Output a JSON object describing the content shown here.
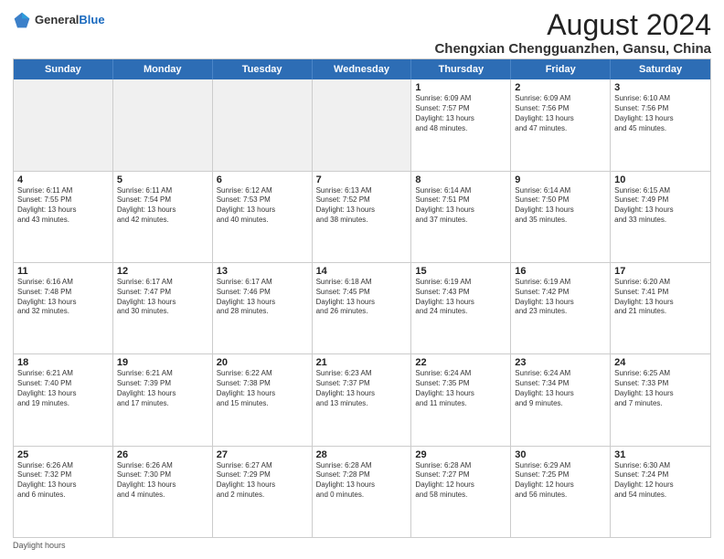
{
  "header": {
    "logo_general": "General",
    "logo_blue": "Blue",
    "month_title": "August 2024",
    "location": "Chengxian Chengguanzhen, Gansu, China"
  },
  "days_of_week": [
    "Sunday",
    "Monday",
    "Tuesday",
    "Wednesday",
    "Thursday",
    "Friday",
    "Saturday"
  ],
  "footer_text": "Daylight hours",
  "weeks": [
    [
      {
        "day": "",
        "info": "",
        "shaded": true
      },
      {
        "day": "",
        "info": "",
        "shaded": true
      },
      {
        "day": "",
        "info": "",
        "shaded": true
      },
      {
        "day": "",
        "info": "",
        "shaded": true
      },
      {
        "day": "1",
        "info": "Sunrise: 6:09 AM\nSunset: 7:57 PM\nDaylight: 13 hours\nand 48 minutes."
      },
      {
        "day": "2",
        "info": "Sunrise: 6:09 AM\nSunset: 7:56 PM\nDaylight: 13 hours\nand 47 minutes."
      },
      {
        "day": "3",
        "info": "Sunrise: 6:10 AM\nSunset: 7:56 PM\nDaylight: 13 hours\nand 45 minutes."
      }
    ],
    [
      {
        "day": "4",
        "info": "Sunrise: 6:11 AM\nSunset: 7:55 PM\nDaylight: 13 hours\nand 43 minutes."
      },
      {
        "day": "5",
        "info": "Sunrise: 6:11 AM\nSunset: 7:54 PM\nDaylight: 13 hours\nand 42 minutes."
      },
      {
        "day": "6",
        "info": "Sunrise: 6:12 AM\nSunset: 7:53 PM\nDaylight: 13 hours\nand 40 minutes."
      },
      {
        "day": "7",
        "info": "Sunrise: 6:13 AM\nSunset: 7:52 PM\nDaylight: 13 hours\nand 38 minutes."
      },
      {
        "day": "8",
        "info": "Sunrise: 6:14 AM\nSunset: 7:51 PM\nDaylight: 13 hours\nand 37 minutes."
      },
      {
        "day": "9",
        "info": "Sunrise: 6:14 AM\nSunset: 7:50 PM\nDaylight: 13 hours\nand 35 minutes."
      },
      {
        "day": "10",
        "info": "Sunrise: 6:15 AM\nSunset: 7:49 PM\nDaylight: 13 hours\nand 33 minutes."
      }
    ],
    [
      {
        "day": "11",
        "info": "Sunrise: 6:16 AM\nSunset: 7:48 PM\nDaylight: 13 hours\nand 32 minutes."
      },
      {
        "day": "12",
        "info": "Sunrise: 6:17 AM\nSunset: 7:47 PM\nDaylight: 13 hours\nand 30 minutes."
      },
      {
        "day": "13",
        "info": "Sunrise: 6:17 AM\nSunset: 7:46 PM\nDaylight: 13 hours\nand 28 minutes."
      },
      {
        "day": "14",
        "info": "Sunrise: 6:18 AM\nSunset: 7:45 PM\nDaylight: 13 hours\nand 26 minutes."
      },
      {
        "day": "15",
        "info": "Sunrise: 6:19 AM\nSunset: 7:43 PM\nDaylight: 13 hours\nand 24 minutes."
      },
      {
        "day": "16",
        "info": "Sunrise: 6:19 AM\nSunset: 7:42 PM\nDaylight: 13 hours\nand 23 minutes."
      },
      {
        "day": "17",
        "info": "Sunrise: 6:20 AM\nSunset: 7:41 PM\nDaylight: 13 hours\nand 21 minutes."
      }
    ],
    [
      {
        "day": "18",
        "info": "Sunrise: 6:21 AM\nSunset: 7:40 PM\nDaylight: 13 hours\nand 19 minutes."
      },
      {
        "day": "19",
        "info": "Sunrise: 6:21 AM\nSunset: 7:39 PM\nDaylight: 13 hours\nand 17 minutes."
      },
      {
        "day": "20",
        "info": "Sunrise: 6:22 AM\nSunset: 7:38 PM\nDaylight: 13 hours\nand 15 minutes."
      },
      {
        "day": "21",
        "info": "Sunrise: 6:23 AM\nSunset: 7:37 PM\nDaylight: 13 hours\nand 13 minutes."
      },
      {
        "day": "22",
        "info": "Sunrise: 6:24 AM\nSunset: 7:35 PM\nDaylight: 13 hours\nand 11 minutes."
      },
      {
        "day": "23",
        "info": "Sunrise: 6:24 AM\nSunset: 7:34 PM\nDaylight: 13 hours\nand 9 minutes."
      },
      {
        "day": "24",
        "info": "Sunrise: 6:25 AM\nSunset: 7:33 PM\nDaylight: 13 hours\nand 7 minutes."
      }
    ],
    [
      {
        "day": "25",
        "info": "Sunrise: 6:26 AM\nSunset: 7:32 PM\nDaylight: 13 hours\nand 6 minutes."
      },
      {
        "day": "26",
        "info": "Sunrise: 6:26 AM\nSunset: 7:30 PM\nDaylight: 13 hours\nand 4 minutes."
      },
      {
        "day": "27",
        "info": "Sunrise: 6:27 AM\nSunset: 7:29 PM\nDaylight: 13 hours\nand 2 minutes."
      },
      {
        "day": "28",
        "info": "Sunrise: 6:28 AM\nSunset: 7:28 PM\nDaylight: 13 hours\nand 0 minutes."
      },
      {
        "day": "29",
        "info": "Sunrise: 6:28 AM\nSunset: 7:27 PM\nDaylight: 12 hours\nand 58 minutes."
      },
      {
        "day": "30",
        "info": "Sunrise: 6:29 AM\nSunset: 7:25 PM\nDaylight: 12 hours\nand 56 minutes."
      },
      {
        "day": "31",
        "info": "Sunrise: 6:30 AM\nSunset: 7:24 PM\nDaylight: 12 hours\nand 54 minutes."
      }
    ]
  ]
}
